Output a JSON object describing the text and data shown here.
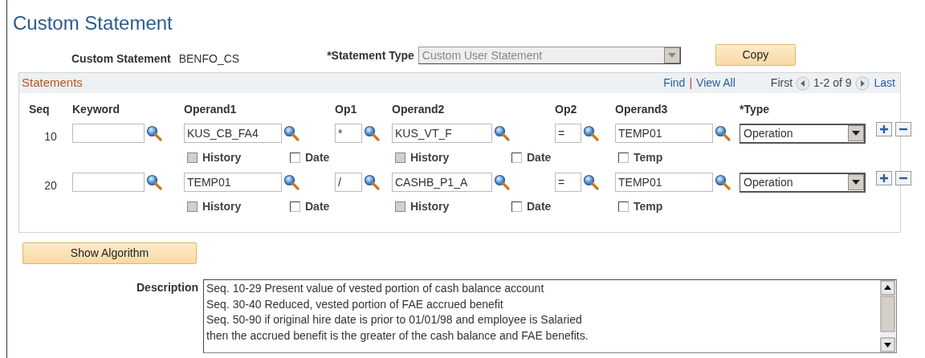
{
  "page_title": "Custom Statement",
  "header": {
    "custom_statement_label": "Custom Statement",
    "custom_statement_value": "BENFO_CS",
    "statement_type_label": "*Statement Type",
    "statement_type_value": "Custom User Statement",
    "statement_type_disabled": true,
    "copy_button": "Copy"
  },
  "statements": {
    "title": "Statements",
    "links": [
      "Find",
      "View All"
    ],
    "link_separator": "|",
    "pager": {
      "first": "First",
      "range": "1-2 of 9",
      "last": "Last"
    },
    "columns": [
      "Seq",
      "Keyword",
      "Operand1",
      "Op1",
      "Operand2",
      "Op2",
      "Operand3",
      "*Type"
    ],
    "rows": [
      {
        "seq": "10",
        "operand1": "KUS_CB_FA4",
        "op1": "*",
        "operand2": "KUS_VT_F",
        "op2": "=",
        "operand3": "TEMP01",
        "type": "Operation",
        "checks": [
          {
            "label": "History",
            "checked": false,
            "disabled": true
          },
          {
            "label": "Date",
            "checked": false,
            "disabled": false
          },
          {
            "label": "History",
            "checked": false,
            "disabled": true
          },
          {
            "label": "Date",
            "checked": false,
            "disabled": false
          },
          {
            "label": "Temp",
            "checked": false,
            "disabled": false
          }
        ]
      },
      {
        "seq": "20",
        "operand1": "TEMP01",
        "op1": "/",
        "operand2": "CASHB_P1_A",
        "op2": "=",
        "operand3": "TEMP01",
        "type": "Operation",
        "checks": [
          {
            "label": "History",
            "checked": false,
            "disabled": true
          },
          {
            "label": "Date",
            "checked": false,
            "disabled": false
          },
          {
            "label": "History",
            "checked": false,
            "disabled": true
          },
          {
            "label": "Date",
            "checked": false,
            "disabled": false
          },
          {
            "label": "Temp",
            "checked": false,
            "disabled": false
          }
        ]
      }
    ]
  },
  "show_algorithm_button": "Show Algorithm",
  "description": {
    "label": "Description",
    "lines": [
      "Seq. 10-29 Present value of vested portion of cash balance account",
      "Seq. 30-40 Reduced, vested portion of FAE accrued benefit",
      "Seq. 50-90 if original hire date is prior to 01/01/98 and employee is Salaried",
      "then the accrued benefit is the greater of the cash balance and FAE benefits."
    ]
  }
}
